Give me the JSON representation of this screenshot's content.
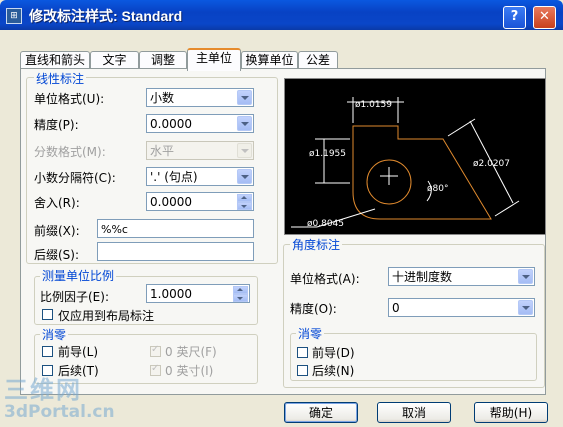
{
  "window": {
    "title": "修改标注样式: Standard",
    "help_btn": "?",
    "close_btn": "✕"
  },
  "tabs": [
    "直线和箭头",
    "文字",
    "调整",
    "主单位",
    "换算单位",
    "公差"
  ],
  "linear": {
    "title": "线性标注",
    "unit_format_label": "单位格式(U):",
    "unit_format_value": "小数",
    "precision_label": "精度(P):",
    "precision_value": "0.0000",
    "fraction_label": "分数格式(M):",
    "fraction_value": "水平",
    "decimal_sep_label": "小数分隔符(C):",
    "decimal_sep_value": "'.' (句点)",
    "round_label": "舍入(R):",
    "round_value": "0.0000",
    "prefix_label": "前缀(X):",
    "prefix_value": "%%c",
    "suffix_label": "后缀(S):",
    "suffix_value": ""
  },
  "scale": {
    "title": "测量单位比例",
    "factor_label": "比例因子(E):",
    "factor_value": "1.0000",
    "layout_only_label": "仅应用到布局标注"
  },
  "zero_left": {
    "title": "消零",
    "leading": "前导(L)",
    "trailing": "后续(T)",
    "feet": "0 英尺(F)",
    "inches": "0 英寸(I)"
  },
  "preview": {
    "dim_top": "ø1.0159",
    "dim_left": "ø1.1955",
    "dim_right": "ø2.0207",
    "dim_angle": "ø80°",
    "dim_bottom": "ø0.8045"
  },
  "angular": {
    "title": "角度标注",
    "unit_format_label": "单位格式(A):",
    "unit_format_value": "十进制度数",
    "precision_label": "精度(O):",
    "precision_value": "0"
  },
  "zero_right": {
    "title": "消零",
    "leading": "前导(D)",
    "trailing": "后续(N)"
  },
  "buttons": {
    "ok": "确定",
    "cancel": "取消",
    "help": "帮助(H)"
  },
  "watermark": {
    "line1": "三维网",
    "line2": "3dPortal.cn"
  }
}
